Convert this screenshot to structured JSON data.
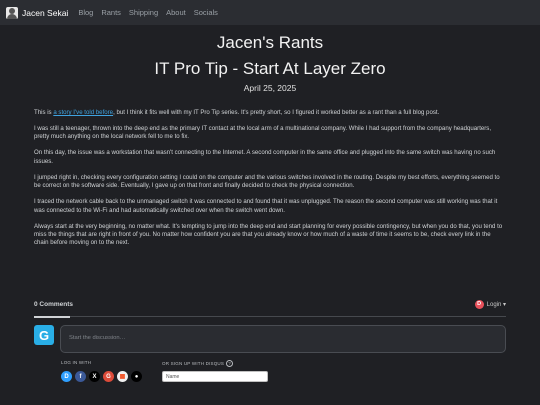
{
  "nav": {
    "brand": "Jacen Sekai",
    "links": [
      "Blog",
      "Rants",
      "Shipping",
      "About",
      "Socials"
    ]
  },
  "header": {
    "blog_title": "Jacen's Rants",
    "post_title": "IT Pro Tip - Start At Layer Zero",
    "date": "April 25, 2025"
  },
  "article": {
    "p1_before": "This is ",
    "p1_link": "a story I've told before",
    "p1_after": ", but I think it fits well with my IT Pro Tip series. It's pretty short, so I figured it worked better as a rant than a full blog post.",
    "paragraphs": [
      "I was still a teenager, thrown into the deep end as the primary IT contact at the local arm of a multinational company. While I had support from the company headquarters, pretty much anything on the local network fell to me to fix.",
      "On this day, the issue was a workstation that wasn't connecting to the Internet. A second computer in the same office and plugged into the same switch was having no such issues.",
      "I jumped right in, checking every configuration setting I could on the computer and the various switches involved in the routing. Despite my best efforts, everything seemed to be correct on the software side. Eventually, I gave up on that front and finally decided to check the physical connection.",
      "I traced the network cable back to the unmanaged switch it was connected to and found that it was unplugged. The reason the second computer was still working was that it was connected to the Wi-Fi and had automatically switched over when the switch went down.",
      "Always start at the very beginning, no matter what. It's tempting to jump into the deep end and start planning for every possible contingency, but when you do that, you tend to miss the things that are right in front of you. No matter how confident you are that you already know or how much of a waste of time it seems to be, check every link in the chain before moving on to the next."
    ]
  },
  "comments": {
    "count": "0 Comments",
    "login": "Login ▾",
    "disqus_letter": "D",
    "avatar_letter": "G",
    "placeholder": "Start the discussion…",
    "login_with": "LOG IN WITH",
    "signup_label": "OR SIGN UP WITH DISQUS",
    "help": "?",
    "name_placeholder": "Name",
    "sso": [
      {
        "name": "disqus",
        "glyph": "D",
        "color": "#2e9fff"
      },
      {
        "name": "facebook",
        "glyph": "f",
        "color": "#3b5998"
      },
      {
        "name": "x",
        "glyph": "X",
        "color": "#000000"
      },
      {
        "name": "google",
        "glyph": "G",
        "color": "#dd4b39"
      },
      {
        "name": "microsoft",
        "glyph": "▦",
        "color": "#f1f1f1"
      },
      {
        "name": "apple",
        "glyph": "●",
        "color": "#000000"
      }
    ]
  }
}
